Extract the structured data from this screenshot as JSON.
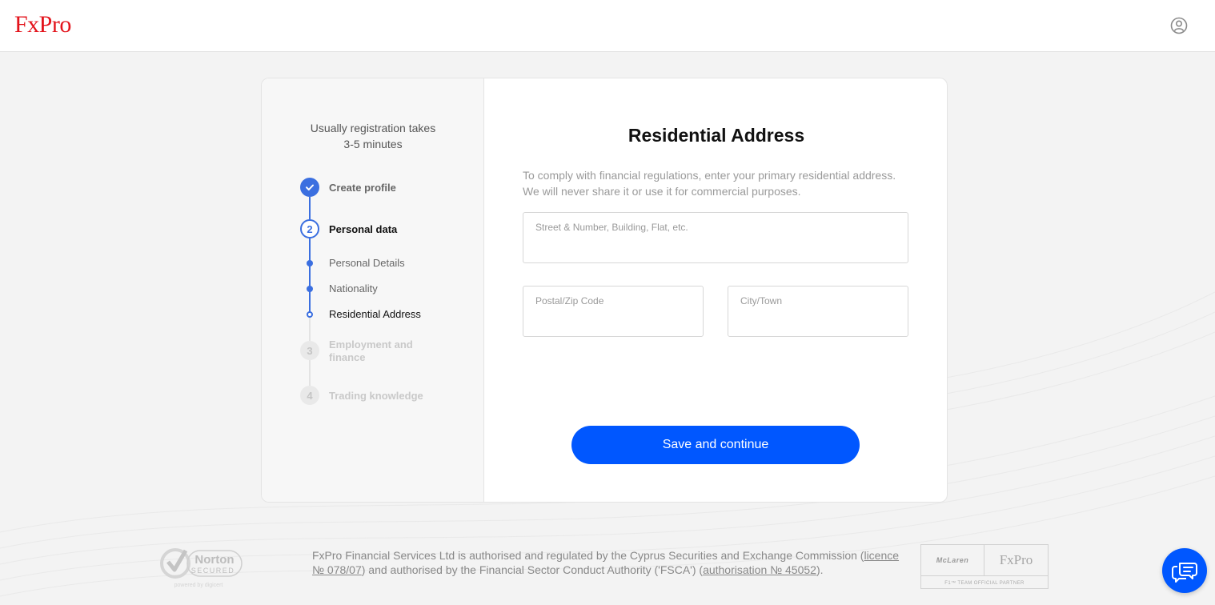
{
  "header": {
    "logo_text": "FxPro",
    "account_icon": "user-circle-icon"
  },
  "sidebar": {
    "note_line1": "Usually registration takes",
    "note_line2": "3-5 minutes",
    "steps": [
      {
        "number": "1",
        "label": "Create profile",
        "state": "done",
        "icon": "check-icon"
      },
      {
        "number": "2",
        "label": "Personal data",
        "state": "active",
        "substeps": [
          {
            "label": "Personal Details",
            "state": "done"
          },
          {
            "label": "Nationality",
            "state": "done"
          },
          {
            "label": "Residential Address",
            "state": "current"
          }
        ]
      },
      {
        "number": "3",
        "label": "Employment and finance",
        "label_line1": "Employment and",
        "label_line2": "finance",
        "state": "todo"
      },
      {
        "number": "4",
        "label": "Trading knowledge",
        "state": "todo"
      }
    ]
  },
  "form": {
    "title": "Residential Address",
    "description": "To comply with financial regulations, enter your primary residential address. We will never share it or use it for commercial purposes.",
    "fields": {
      "street": {
        "label": "Street & Number, Building, Flat, etc.",
        "value": ""
      },
      "postal": {
        "label": "Postal/Zip Code",
        "value": ""
      },
      "city": {
        "label": "City/Town",
        "value": ""
      }
    },
    "submit_label": "Save and continue"
  },
  "footer": {
    "norton_title": "Norton",
    "norton_subtitle": "SECURED",
    "norton_powered": "powered by digicert",
    "legal_part1": "FxPro Financial Services Ltd is authorised and regulated by the Cyprus Securities and Exchange Commission (",
    "legal_link1": "licence № 078/07",
    "legal_part2": ") and authorised by the Financial Sector Conduct Authority ('FSCA') (",
    "legal_link2": "authorisation № 45052",
    "legal_part3": ").",
    "partner_left": "McLaren",
    "partner_right": "FxPro",
    "partner_bottom": "F1™ TEAM OFFICIAL PARTNER"
  },
  "chat": {
    "icon": "chat-bubbles-icon"
  },
  "colors": {
    "brand_red": "#e3141c",
    "primary_blue": "#0057ff",
    "step_blue": "#3b6fe0"
  }
}
